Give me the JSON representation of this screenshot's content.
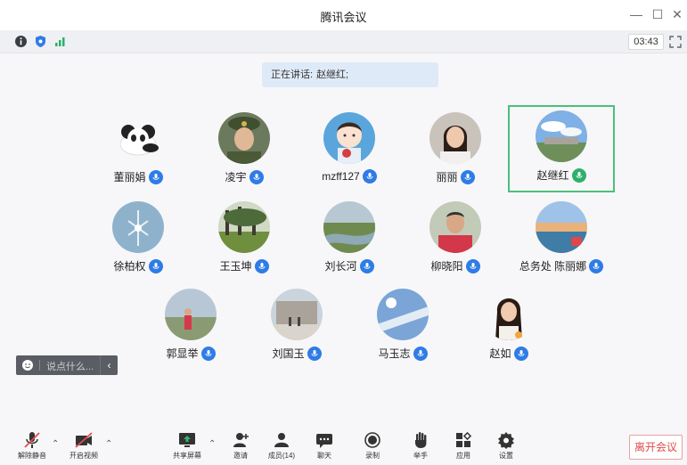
{
  "window": {
    "title": "腾讯会议",
    "minimize": "—",
    "maximize": "☐",
    "close": "✕"
  },
  "toolbar": {
    "timer": "03:43"
  },
  "speaking": {
    "label": "正在讲话:",
    "name": "赵继红;"
  },
  "participants": [
    {
      "name": "董丽娟",
      "avatar": "panda-icon",
      "mic": "blue"
    },
    {
      "name": "凌宇",
      "avatar": "uniform-portrait-icon",
      "mic": "blue"
    },
    {
      "name": "mzff127",
      "avatar": "cartoon-girl-icon",
      "mic": "blue"
    },
    {
      "name": "丽丽",
      "avatar": "woman-portrait-icon",
      "mic": "blue"
    },
    {
      "name": "赵继红",
      "avatar": "sky-landscape-icon",
      "mic": "green",
      "active": true
    },
    {
      "name": "徐柏权",
      "avatar": "frost-icon",
      "mic": "blue"
    },
    {
      "name": "王玉坤",
      "avatar": "trees-icon",
      "mic": "blue"
    },
    {
      "name": "刘长河",
      "avatar": "river-icon",
      "mic": "blue"
    },
    {
      "name": "柳晓阳",
      "avatar": "man-portrait-icon",
      "mic": "blue"
    },
    {
      "name": "总务处 陈丽娜",
      "avatar": "sunset-icon",
      "mic": "blue"
    },
    {
      "name": "郭显举",
      "avatar": "outdoor-person-icon",
      "mic": "blue"
    },
    {
      "name": "刘国玉",
      "avatar": "building-icon",
      "mic": "blue"
    },
    {
      "name": "马玉志",
      "avatar": "sky-icon",
      "mic": "blue"
    },
    {
      "name": "赵如",
      "avatar": "woman-long-hair-icon",
      "mic": "blue"
    }
  ],
  "chat": {
    "placeholder": "说点什么...",
    "toggle": "‹"
  },
  "controls": {
    "unmute": "解除静音",
    "start_video": "开启视频",
    "share_screen": "共享屏幕",
    "invite": "邀请",
    "members": "成员(14)",
    "chat": "聊天",
    "record": "录制",
    "raise_hand": "举手",
    "apps": "应用",
    "settings": "设置",
    "leave": "离开会议"
  },
  "colors": {
    "accent": "#2f7ce6",
    "speaking_border": "#4cbf7a",
    "leave": "#e04b4b"
  }
}
